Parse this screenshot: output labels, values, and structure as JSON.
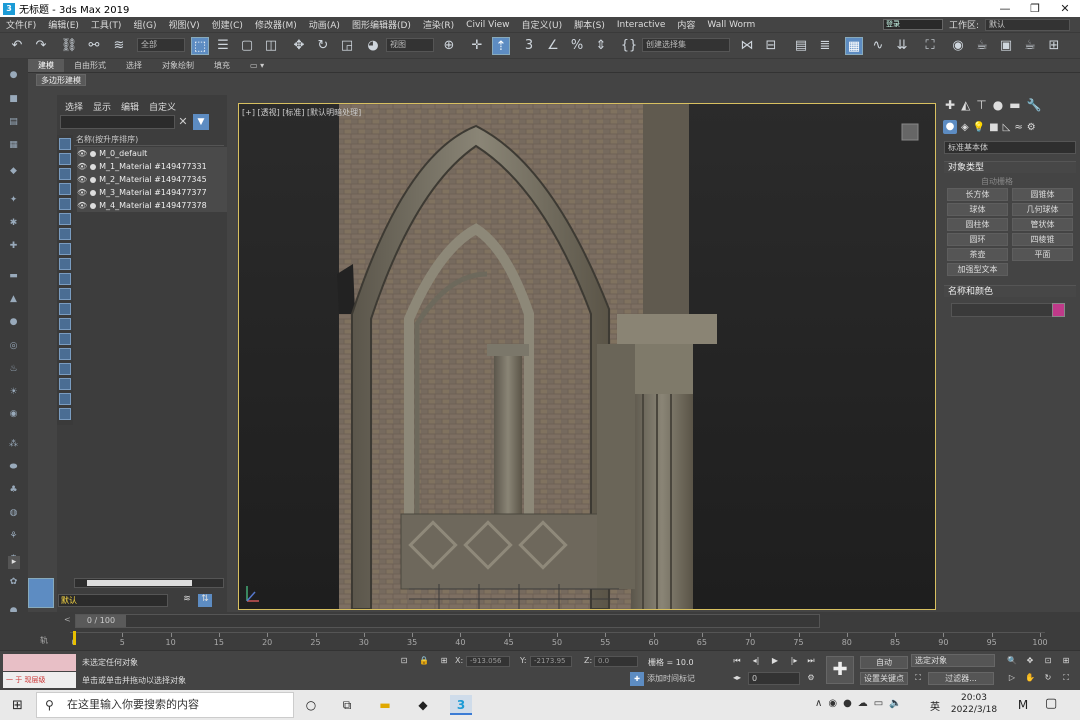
{
  "window": {
    "title": "无标题 - 3ds Max 2019",
    "app_icon": "3"
  },
  "menu": {
    "items": [
      "文件(F)",
      "编辑(E)",
      "工具(T)",
      "组(G)",
      "视图(V)",
      "创建(C)",
      "修改器(M)",
      "动画(A)",
      "图形编辑器(D)",
      "渲染(R)",
      "Civil View",
      "自定义(U)",
      "脚本(S)",
      "Interactive",
      "内容",
      "Wall Worm"
    ],
    "user_value": "登录",
    "workspace_label": "工作区:",
    "workspace_value": "默认"
  },
  "toolbar": {
    "filter_value": "全部",
    "view_value": "视图",
    "selection_set_value": "创建选择集"
  },
  "ribbon": {
    "tabs": [
      "建模",
      "自由形式",
      "选择",
      "对象绘制",
      "填充"
    ],
    "active_tab": "建模",
    "sub_chip": "多边形建模"
  },
  "scene_explorer": {
    "tabs": [
      "选择",
      "显示",
      "编辑",
      "自定义"
    ],
    "column_header": "名称(按升序排序)",
    "items": [
      "M_0_default",
      "M_1_Material #149477331",
      "M_2_Material #149477345",
      "M_3_Material #149477377",
      "M_4_Material #149477378"
    ],
    "layer_value": "默认"
  },
  "viewport": {
    "label": "[+] [透视] [标准] [默认明暗处理]"
  },
  "command_panel": {
    "category": "标准基本体",
    "section_object_type": "对象类型",
    "autogrid": "自动栅格",
    "buttons": [
      "长方体",
      "圆锥体",
      "球体",
      "几何球体",
      "圆柱体",
      "管状体",
      "圆环",
      "四棱锥",
      "茶壶",
      "平面",
      "加强型文本"
    ],
    "section_name_color": "名称和颜色",
    "object_color": "#c03a8a"
  },
  "timeline": {
    "slider_text": "0 / 100",
    "key_label": "轨",
    "ticks": [
      "0",
      "5",
      "10",
      "15",
      "20",
      "25",
      "30",
      "35",
      "40",
      "45",
      "50",
      "55",
      "60",
      "65",
      "70",
      "75",
      "80",
      "85",
      "90",
      "95",
      "100"
    ]
  },
  "status": {
    "maxscript_label": "一 于 现层级",
    "line1": "未选定任何对象",
    "line2": "单击或单击并拖动以选择对象",
    "x_label": "X:",
    "x_value": "-913.056",
    "y_label": "Y:",
    "y_value": "-2173.95",
    "z_label": "Z:",
    "z_value": "0.0",
    "grid_text": "栅格 = 10.0",
    "add_time_tag": "添加时间标记",
    "frame_value": "0",
    "auto_button": "自动",
    "selected_object": "选定对象",
    "set_key": "设置关键点",
    "key_filters": "过滤器..."
  },
  "taskbar": {
    "search_placeholder": "在这里输入你要搜索的内容",
    "time": "20:03",
    "date": "2022/3/18",
    "ime": "英"
  }
}
